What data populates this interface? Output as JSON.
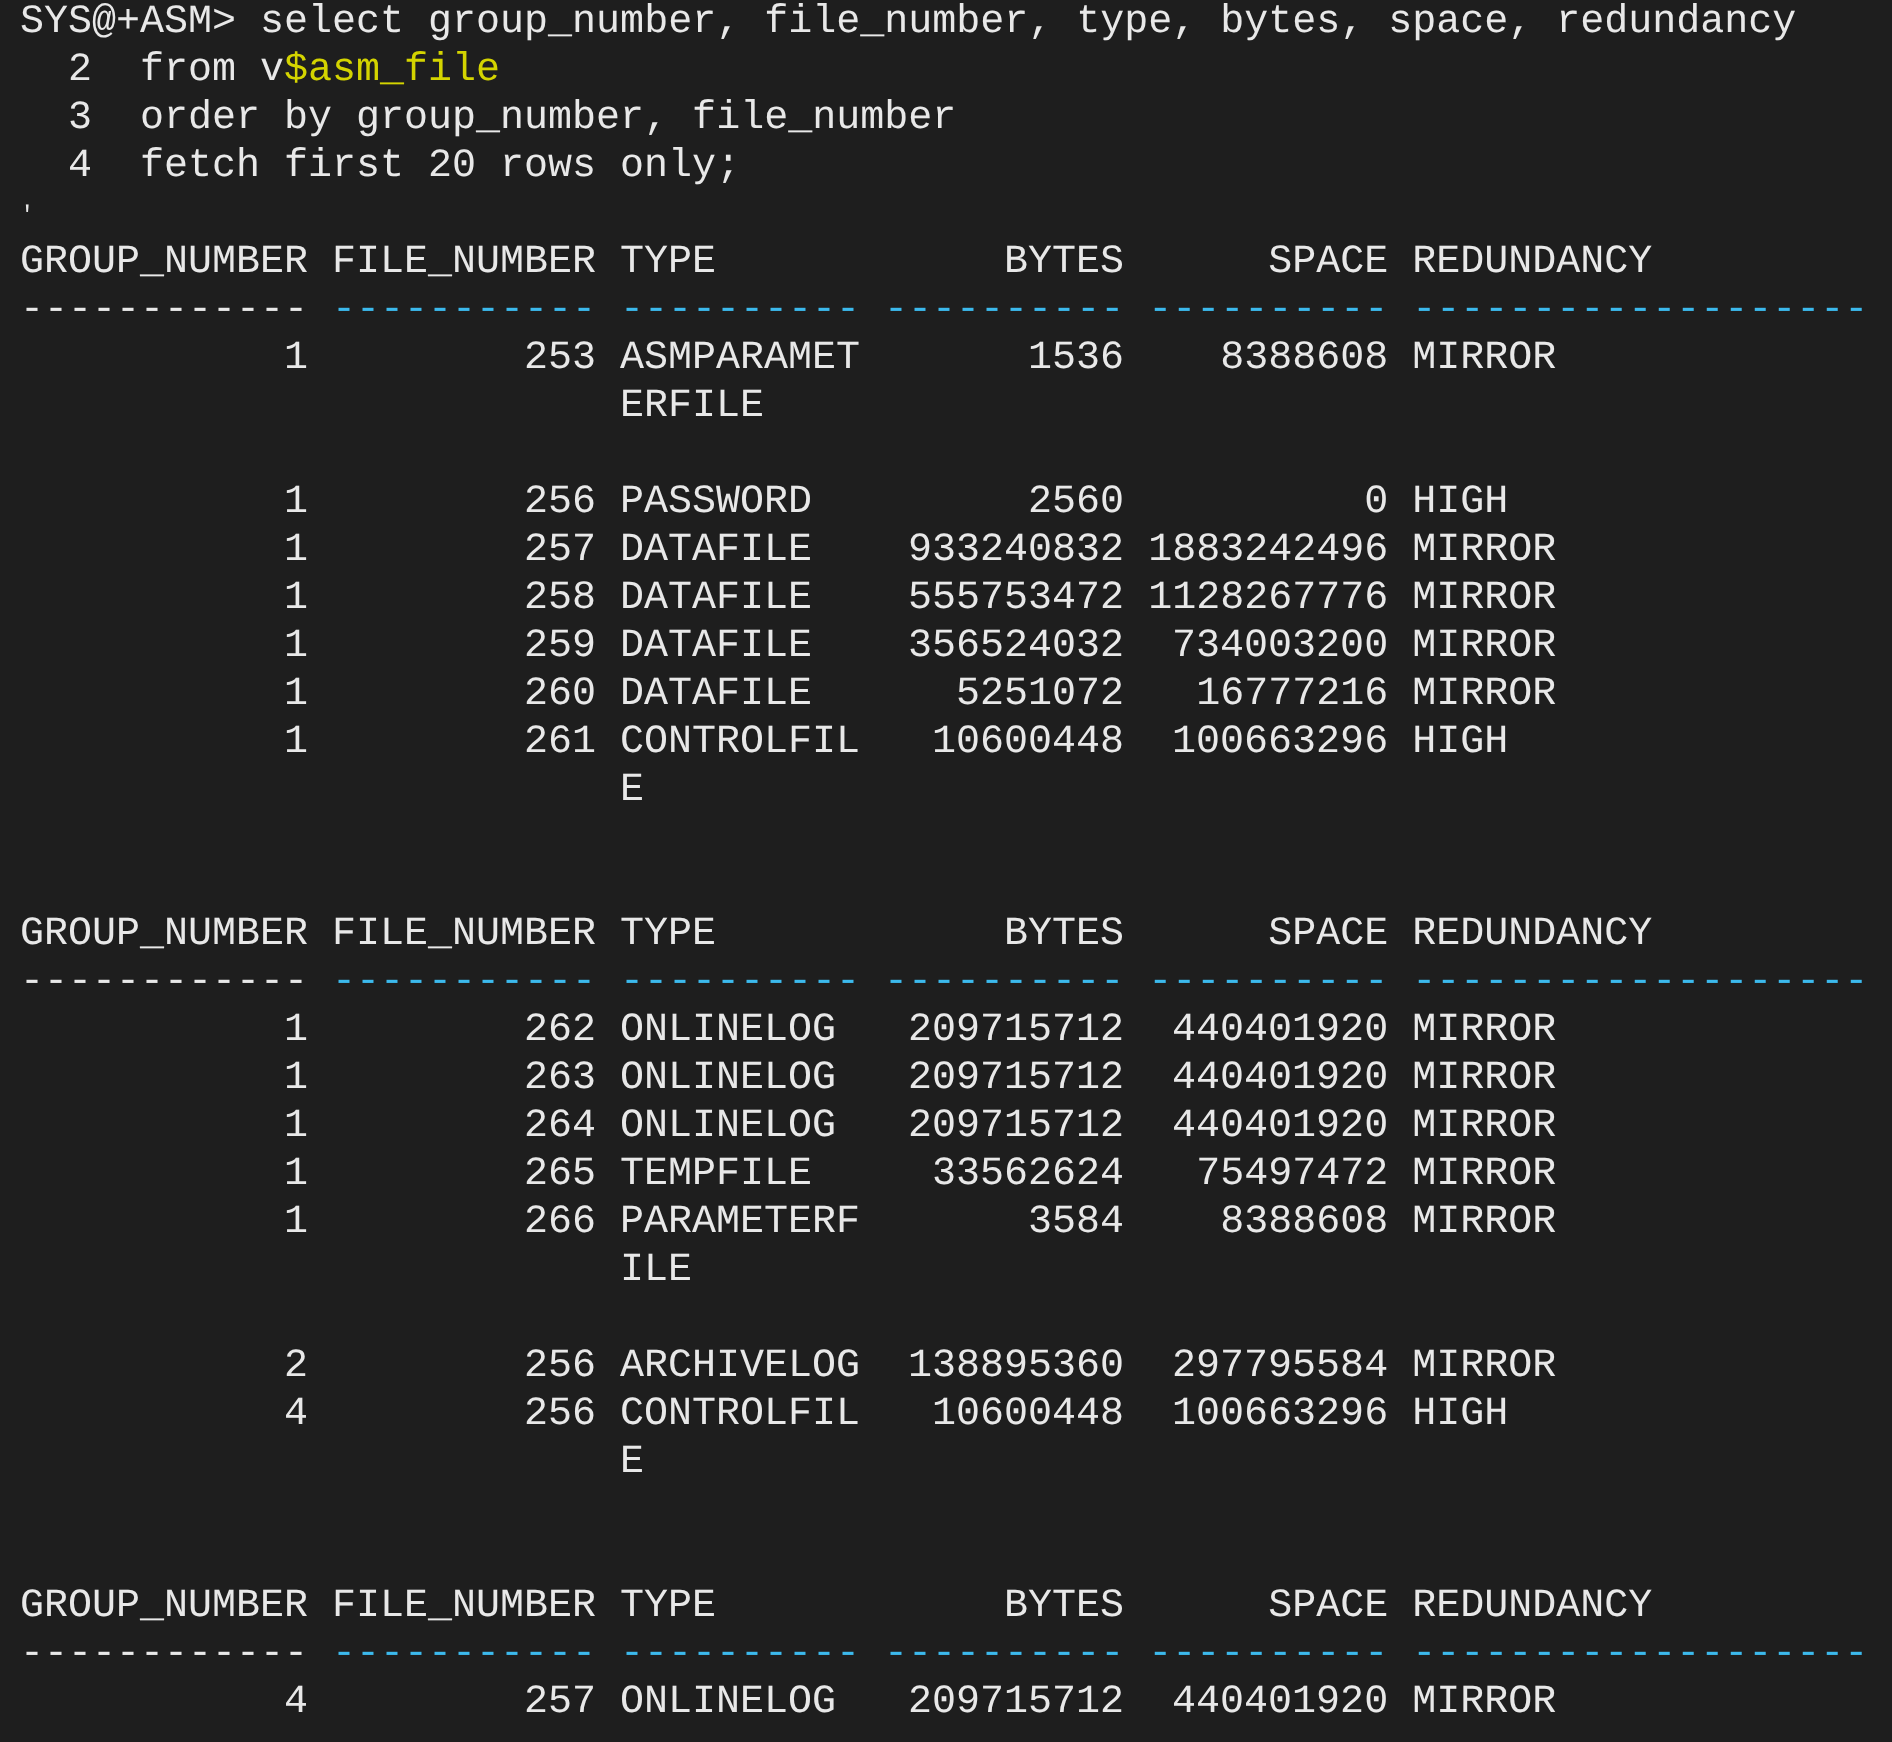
{
  "command_lines": [
    {
      "kind": "prompt",
      "prefix": "SYS@+ASM>",
      "segments": [
        {
          "text": "select group_number, file_number, type, bytes, space, redundancy",
          "highlighted": false
        }
      ]
    },
    {
      "kind": "continuation",
      "prefix": "2",
      "segments": [
        {
          "text": "from v",
          "highlighted": false
        },
        {
          "text": "$asm_file",
          "highlighted": true
        }
      ]
    },
    {
      "kind": "continuation",
      "prefix": "3",
      "segments": [
        {
          "text": "order by group_number, file_number",
          "highlighted": false
        }
      ]
    },
    {
      "kind": "continuation",
      "prefix": "4",
      "segments": [
        {
          "text": "fetch first 20 rows only;",
          "highlighted": false
        }
      ]
    }
  ],
  "stray_mark": "'",
  "columns": [
    {
      "kind": "number",
      "underline_highlighted": false
    },
    {
      "kind": "number",
      "underline_highlighted": true
    },
    {
      "kind": "text",
      "underline_highlighted": true
    },
    {
      "kind": "number",
      "underline_highlighted": true
    },
    {
      "kind": "number",
      "underline_highlighted": true
    },
    {
      "kind": "text",
      "underline_highlighted": true
    }
  ],
  "pages": [
    {
      "header": [
        "GROUP_NUMBER",
        "FILE_NUMBER",
        "TYPE",
        "BYTES",
        "SPACE",
        "REDUNDANCY"
      ],
      "underline": [
        "------------",
        "-----------",
        "----------",
        "----------",
        "----------",
        "-------------------"
      ],
      "rows": [
        {
          "cells": [
            [
              "1"
            ],
            [
              "253"
            ],
            [
              "ASMPARAMET",
              "ERFILE"
            ],
            [
              "1536"
            ],
            [
              "8388608"
            ],
            [
              "MIRROR"
            ]
          ]
        },
        {
          "cells": [
            [
              "1"
            ],
            [
              "256"
            ],
            [
              "PASSWORD"
            ],
            [
              "2560"
            ],
            [
              "0"
            ],
            [
              "HIGH"
            ]
          ]
        },
        {
          "cells": [
            [
              "1"
            ],
            [
              "257"
            ],
            [
              "DATAFILE"
            ],
            [
              "933240832"
            ],
            [
              "1883242496"
            ],
            [
              "MIRROR"
            ]
          ]
        },
        {
          "cells": [
            [
              "1"
            ],
            [
              "258"
            ],
            [
              "DATAFILE"
            ],
            [
              "555753472"
            ],
            [
              "1128267776"
            ],
            [
              "MIRROR"
            ]
          ]
        },
        {
          "cells": [
            [
              "1"
            ],
            [
              "259"
            ],
            [
              "DATAFILE"
            ],
            [
              "356524032"
            ],
            [
              "734003200"
            ],
            [
              "MIRROR"
            ]
          ]
        },
        {
          "cells": [
            [
              "1"
            ],
            [
              "260"
            ],
            [
              "DATAFILE"
            ],
            [
              "5251072"
            ],
            [
              "16777216"
            ],
            [
              "MIRROR"
            ]
          ]
        },
        {
          "cells": [
            [
              "1"
            ],
            [
              "261"
            ],
            [
              "CONTROLFIL",
              "E"
            ],
            [
              "10600448"
            ],
            [
              "100663296"
            ],
            [
              "HIGH"
            ]
          ]
        }
      ]
    },
    {
      "header": [
        "GROUP_NUMBER",
        "FILE_NUMBER",
        "TYPE",
        "BYTES",
        "SPACE",
        "REDUNDANCY"
      ],
      "underline": [
        "------------",
        "-----------",
        "----------",
        "----------",
        "----------",
        "-------------------"
      ],
      "rows": [
        {
          "cells": [
            [
              "1"
            ],
            [
              "262"
            ],
            [
              "ONLINELOG"
            ],
            [
              "209715712"
            ],
            [
              "440401920"
            ],
            [
              "MIRROR"
            ]
          ]
        },
        {
          "cells": [
            [
              "1"
            ],
            [
              "263"
            ],
            [
              "ONLINELOG"
            ],
            [
              "209715712"
            ],
            [
              "440401920"
            ],
            [
              "MIRROR"
            ]
          ]
        },
        {
          "cells": [
            [
              "1"
            ],
            [
              "264"
            ],
            [
              "ONLINELOG"
            ],
            [
              "209715712"
            ],
            [
              "440401920"
            ],
            [
              "MIRROR"
            ]
          ]
        },
        {
          "cells": [
            [
              "1"
            ],
            [
              "265"
            ],
            [
              "TEMPFILE"
            ],
            [
              "33562624"
            ],
            [
              "75497472"
            ],
            [
              "MIRROR"
            ]
          ]
        },
        {
          "cells": [
            [
              "1"
            ],
            [
              "266"
            ],
            [
              "PARAMETERF",
              "ILE"
            ],
            [
              "3584"
            ],
            [
              "8388608"
            ],
            [
              "MIRROR"
            ]
          ]
        },
        {
          "cells": [
            [
              "2"
            ],
            [
              "256"
            ],
            [
              "ARCHIVELOG"
            ],
            [
              "138895360"
            ],
            [
              "297795584"
            ],
            [
              "MIRROR"
            ]
          ]
        },
        {
          "cells": [
            [
              "4"
            ],
            [
              "256"
            ],
            [
              "CONTROLFIL",
              "E"
            ],
            [
              "10600448"
            ],
            [
              "100663296"
            ],
            [
              "HIGH"
            ]
          ]
        }
      ]
    },
    {
      "header": [
        "GROUP_NUMBER",
        "FILE_NUMBER",
        "TYPE",
        "BYTES",
        "SPACE",
        "REDUNDANCY"
      ],
      "underline": [
        "------------",
        "-----------",
        "----------",
        "----------",
        "----------",
        "-------------------"
      ],
      "rows": [
        {
          "cells": [
            [
              "4"
            ],
            [
              "257"
            ],
            [
              "ONLINELOG"
            ],
            [
              "209715712"
            ],
            [
              "440401920"
            ],
            [
              "MIRROR"
            ]
          ]
        }
      ]
    }
  ]
}
